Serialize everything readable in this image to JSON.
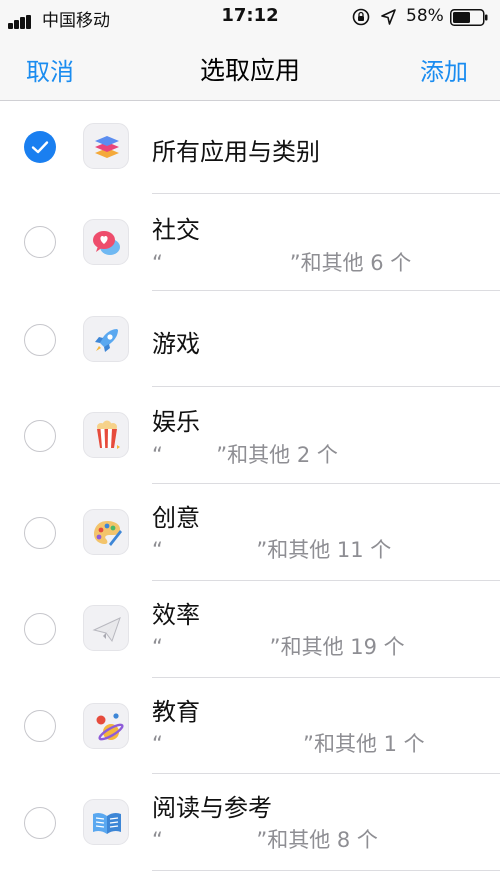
{
  "status_bar": {
    "carrier": "中国移动",
    "time": "17:12",
    "battery": "58%",
    "icons": [
      "signal-icon",
      "orientation-lock-icon",
      "location-arrow-icon",
      "battery-icon"
    ]
  },
  "nav": {
    "cancel": "取消",
    "title": "选取应用",
    "add": "添加"
  },
  "colors": {
    "accent": "#1a8cf0",
    "checkbox_checked": "#1a7ff0",
    "secondary_text": "#8e8e93"
  },
  "rows": [
    {
      "title": "所有应用与类别",
      "subtitle": "",
      "checked": true,
      "icon": "stack-layers-icon"
    },
    {
      "title": "社交",
      "subtitle": "“                   ”和其他 6 个",
      "checked": false,
      "icon": "chat-heart-icon"
    },
    {
      "title": "游戏",
      "subtitle": "",
      "checked": false,
      "icon": "rocket-icon"
    },
    {
      "title": "娱乐",
      "subtitle": "“        ”和其他 2 个",
      "checked": false,
      "icon": "popcorn-icon"
    },
    {
      "title": "创意",
      "subtitle": "“              ”和其他 11 个",
      "checked": false,
      "icon": "palette-icon"
    },
    {
      "title": "效率",
      "subtitle": "“                ”和其他 19 个",
      "checked": false,
      "icon": "paper-plane-icon"
    },
    {
      "title": "教育",
      "subtitle": "“                     ”和其他 1 个",
      "checked": false,
      "icon": "planet-icon"
    },
    {
      "title": "阅读与参考",
      "subtitle": "“              ”和其他 8 个",
      "checked": false,
      "icon": "book-icon"
    }
  ]
}
